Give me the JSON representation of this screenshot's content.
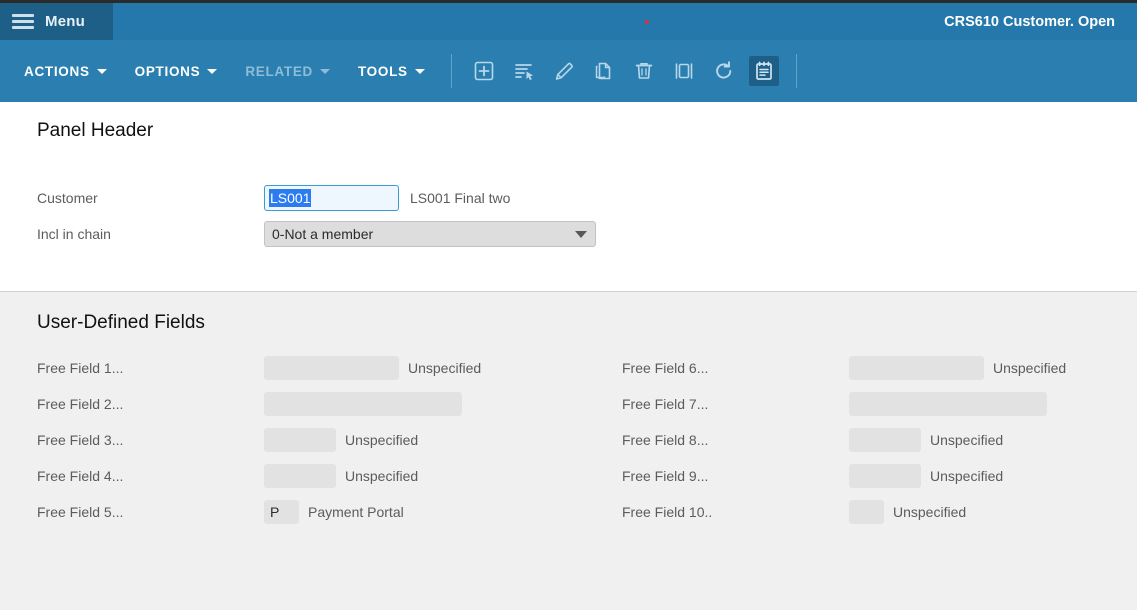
{
  "titlebar": {
    "menu_label": "Menu",
    "window_title": "CRS610 Customer. Open",
    "accent_color": "#2478ab",
    "menu_button_color": "#1d5f86",
    "indicator_color": "#d8323c"
  },
  "toolbar": {
    "menus": [
      {
        "label": "ACTIONS",
        "enabled": true
      },
      {
        "label": "OPTIONS",
        "enabled": true
      },
      {
        "label": "RELATED",
        "enabled": false
      },
      {
        "label": "TOOLS",
        "enabled": true
      }
    ],
    "icons": [
      {
        "name": "add-icon",
        "active": false
      },
      {
        "name": "select-list-icon",
        "active": false
      },
      {
        "name": "edit-pencil-icon",
        "active": false
      },
      {
        "name": "copy-icon",
        "active": false
      },
      {
        "name": "delete-trash-icon",
        "active": false
      },
      {
        "name": "duplicate-icon",
        "active": false
      },
      {
        "name": "refresh-icon",
        "active": false
      },
      {
        "name": "notes-icon",
        "active": true
      }
    ]
  },
  "panel_header": {
    "title": "Panel Header",
    "customer": {
      "label": "Customer",
      "value": "LS001",
      "description": "LS001 Final two",
      "selected": true
    },
    "incl_in_chain": {
      "label": "Incl in chain",
      "value": "0-Not a member",
      "options": [
        "0-Not a member"
      ]
    }
  },
  "user_defined_fields": {
    "title": "User-Defined Fields",
    "left_column": [
      {
        "label": "Free Field 1...",
        "value": "",
        "description": "Unspecified",
        "input_width": 135
      },
      {
        "label": "Free Field 2...",
        "value": "",
        "description": "",
        "input_width": 198
      },
      {
        "label": "Free Field 3...",
        "value": "",
        "description": "Unspecified",
        "input_width": 72
      },
      {
        "label": "Free Field 4...",
        "value": "",
        "description": "Unspecified",
        "input_width": 72
      },
      {
        "label": "Free Field 5...",
        "value": "P",
        "description": "Payment Portal",
        "input_width": 35
      }
    ],
    "right_column": [
      {
        "label": "Free Field 6...",
        "value": "",
        "description": "Unspecified",
        "input_width": 135
      },
      {
        "label": "Free Field 7...",
        "value": "",
        "description": "",
        "input_width": 198
      },
      {
        "label": "Free Field 8...",
        "value": "",
        "description": "Unspecified",
        "input_width": 72
      },
      {
        "label": "Free Field 9...",
        "value": "",
        "description": "Unspecified",
        "input_width": 72
      },
      {
        "label": "Free Field 10..",
        "value": "",
        "description": "Unspecified",
        "input_width": 35
      }
    ]
  }
}
